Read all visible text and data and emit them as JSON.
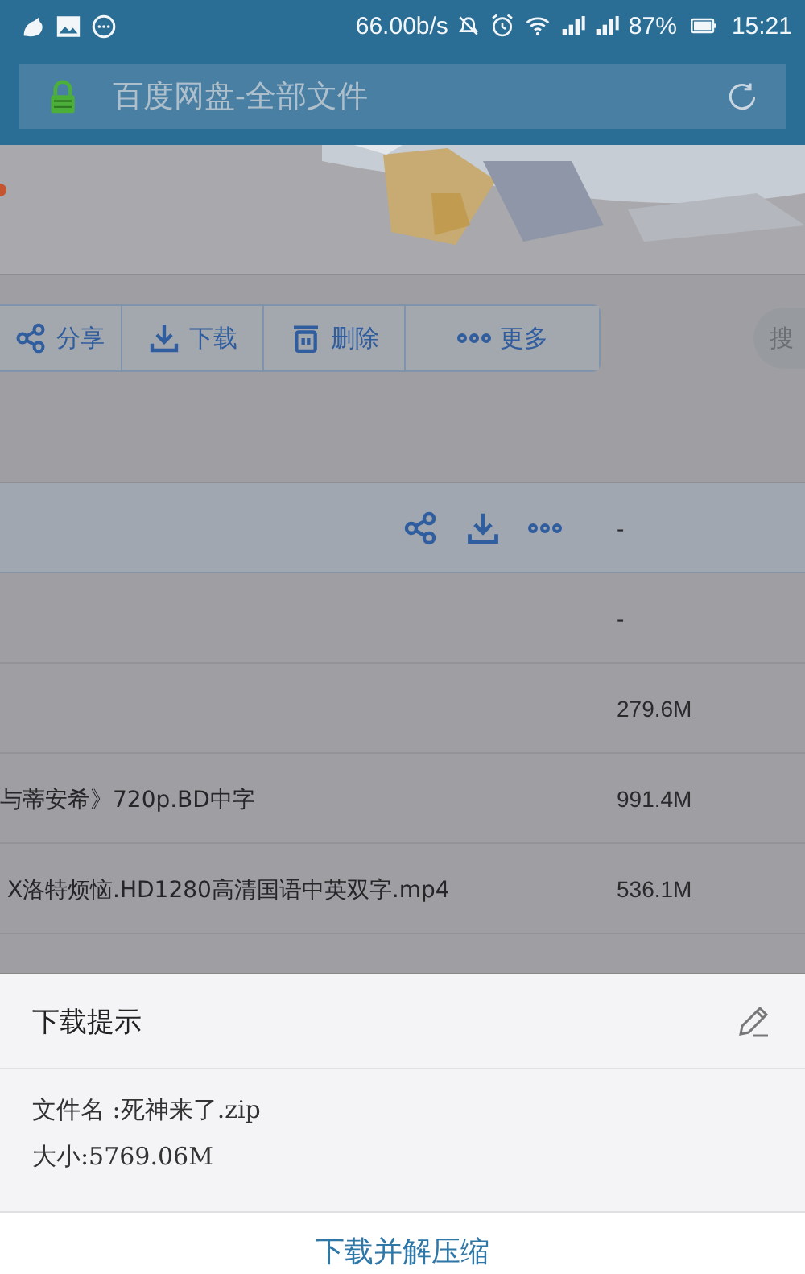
{
  "status_bar": {
    "network_speed": "66.00b/s",
    "battery": "87%",
    "time": "15:21"
  },
  "address_bar": {
    "title": "百度网盘-全部文件"
  },
  "toolbar": {
    "buttons": [
      {
        "kind": "share",
        "label": "分享"
      },
      {
        "kind": "download",
        "label": "下载"
      },
      {
        "kind": "delete",
        "label": "删除"
      },
      {
        "kind": "more",
        "label": "更多"
      }
    ],
    "search_label": "搜"
  },
  "files": [
    {
      "selected": true,
      "size": "-"
    },
    {
      "selected": false,
      "size": "-"
    },
    {
      "selected": false,
      "size": "279.6M"
    },
    {
      "selected": false,
      "name": "与蒂安希》720p.BD中字",
      "size": "991.4M"
    },
    {
      "selected": false,
      "name": " X洛特烦恼.HD1280高清国语中英双字.mp4",
      "size": "536.1M"
    }
  ],
  "dialog": {
    "title": "下载提示",
    "file_name": "文件名 :死神来了.zip",
    "file_size": "大小:5769.06M",
    "button": "下载并解压缩"
  }
}
